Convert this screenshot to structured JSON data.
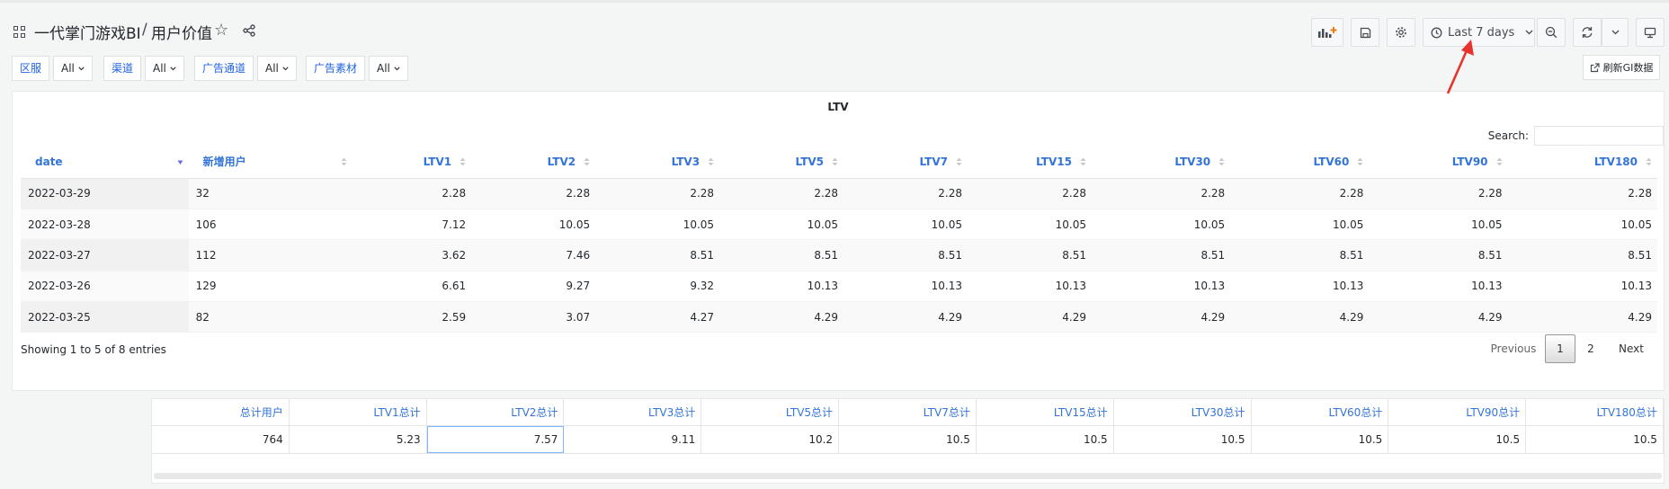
{
  "header": {
    "folder": "一代掌门游戏BI",
    "separator": "/",
    "page_title": "用户价值"
  },
  "toolbar": {
    "time_range_label": "Last 7 days",
    "icons": [
      "add-panel-icon",
      "save-icon",
      "settings-icon",
      "clock-icon",
      "chevron-down-icon",
      "zoom-out-icon",
      "refresh-icon",
      "chevron-down-icon",
      "tv-icon"
    ]
  },
  "variables": [
    {
      "label": "区服",
      "value": "All"
    },
    {
      "label": "渠道",
      "value": "All"
    },
    {
      "label": "广告通道",
      "value": "All"
    },
    {
      "label": "广告素材",
      "value": "All"
    }
  ],
  "refresh_gi_label": "刷新GI数据",
  "ltv_panel": {
    "title": "LTV",
    "search_label": "Search:",
    "columns": [
      "date",
      "新增用户",
      "LTV1",
      "LTV2",
      "LTV3",
      "LTV5",
      "LTV7",
      "LTV15",
      "LTV30",
      "LTV60",
      "LTV90",
      "LTV180"
    ],
    "rows": [
      [
        "2022-03-29",
        "32",
        "2.28",
        "2.28",
        "2.28",
        "2.28",
        "2.28",
        "2.28",
        "2.28",
        "2.28",
        "2.28",
        "2.28"
      ],
      [
        "2022-03-28",
        "106",
        "7.12",
        "10.05",
        "10.05",
        "10.05",
        "10.05",
        "10.05",
        "10.05",
        "10.05",
        "10.05",
        "10.05"
      ],
      [
        "2022-03-27",
        "112",
        "3.62",
        "7.46",
        "8.51",
        "8.51",
        "8.51",
        "8.51",
        "8.51",
        "8.51",
        "8.51",
        "8.51"
      ],
      [
        "2022-03-26",
        "129",
        "6.61",
        "9.27",
        "9.32",
        "10.13",
        "10.13",
        "10.13",
        "10.13",
        "10.13",
        "10.13",
        "10.13"
      ],
      [
        "2022-03-25",
        "82",
        "2.59",
        "3.07",
        "4.27",
        "4.29",
        "4.29",
        "4.29",
        "4.29",
        "4.29",
        "4.29",
        "4.29"
      ]
    ],
    "info": "Showing 1 to 5 of 8 entries",
    "pagination": {
      "previous": "Previous",
      "pages": [
        "1",
        "2"
      ],
      "next": "Next"
    }
  },
  "totals": {
    "headers": [
      "总计用户",
      "LTV1总计",
      "LTV2总计",
      "LTV3总计",
      "LTV5总计",
      "LTV7总计",
      "LTV15总计",
      "LTV30总计",
      "LTV60总计",
      "LTV90总计",
      "LTV180总计"
    ],
    "values": [
      "764",
      "5.23",
      "7.57",
      "9.11",
      "10.2",
      "10.5",
      "10.5",
      "10.5",
      "10.5",
      "10.5",
      "10.5"
    ]
  },
  "colors": {
    "link_blue": "#3274d9",
    "variable_blue": "#1f62e0",
    "annotation_red": "#e8322d"
  }
}
